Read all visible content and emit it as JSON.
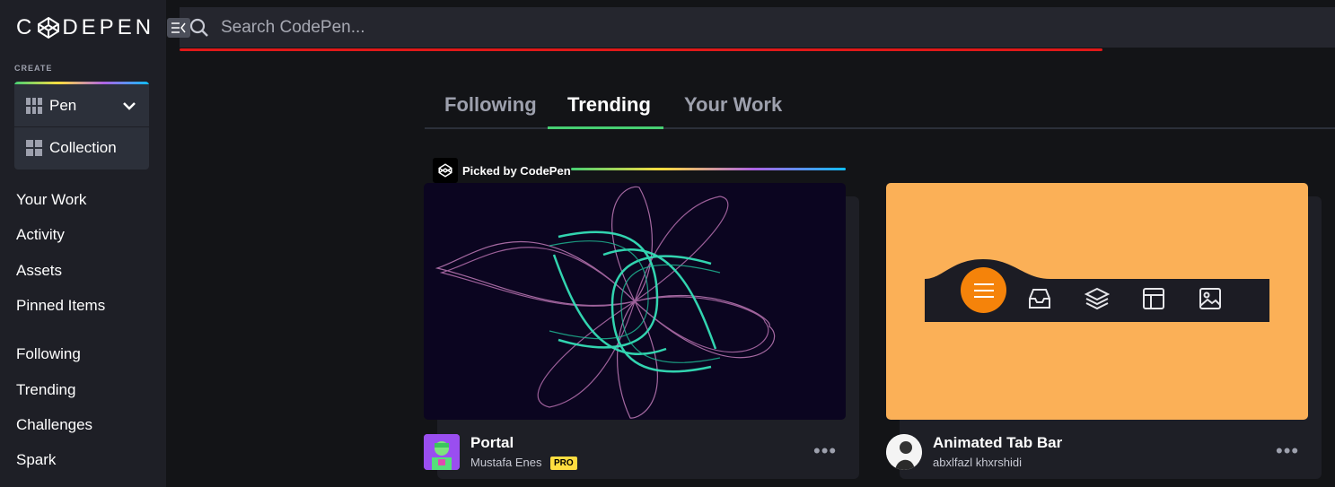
{
  "logo": {
    "text_left": "C",
    "text_right": "DEPEN"
  },
  "sidebar": {
    "create_label": "CREATE",
    "create_items": [
      {
        "label": "Pen"
      },
      {
        "label": "Collection"
      }
    ],
    "nav_primary": [
      "Your Work",
      "Activity",
      "Assets",
      "Pinned Items"
    ],
    "nav_secondary": [
      "Following",
      "Trending",
      "Challenges",
      "Spark"
    ]
  },
  "search": {
    "placeholder": "Search CodePen..."
  },
  "tabs": [
    "Following",
    "Trending",
    "Your Work"
  ],
  "active_tab": "Trending",
  "picked_label": "Picked by CodePen",
  "cards": [
    {
      "title": "Portal",
      "author": "Mustafa Enes",
      "badge": "PRO",
      "more": "•••"
    },
    {
      "title": "Animated Tab Bar",
      "author": "abxlfazl khxrshidi",
      "more": "•••"
    }
  ],
  "colors": {
    "accent_green": "#47cf73",
    "progress_red": "#e01919",
    "tabbar_preview_bg": "#fbb057",
    "menu_orange": "#f5830a",
    "portal_bg": "#0b0520"
  }
}
